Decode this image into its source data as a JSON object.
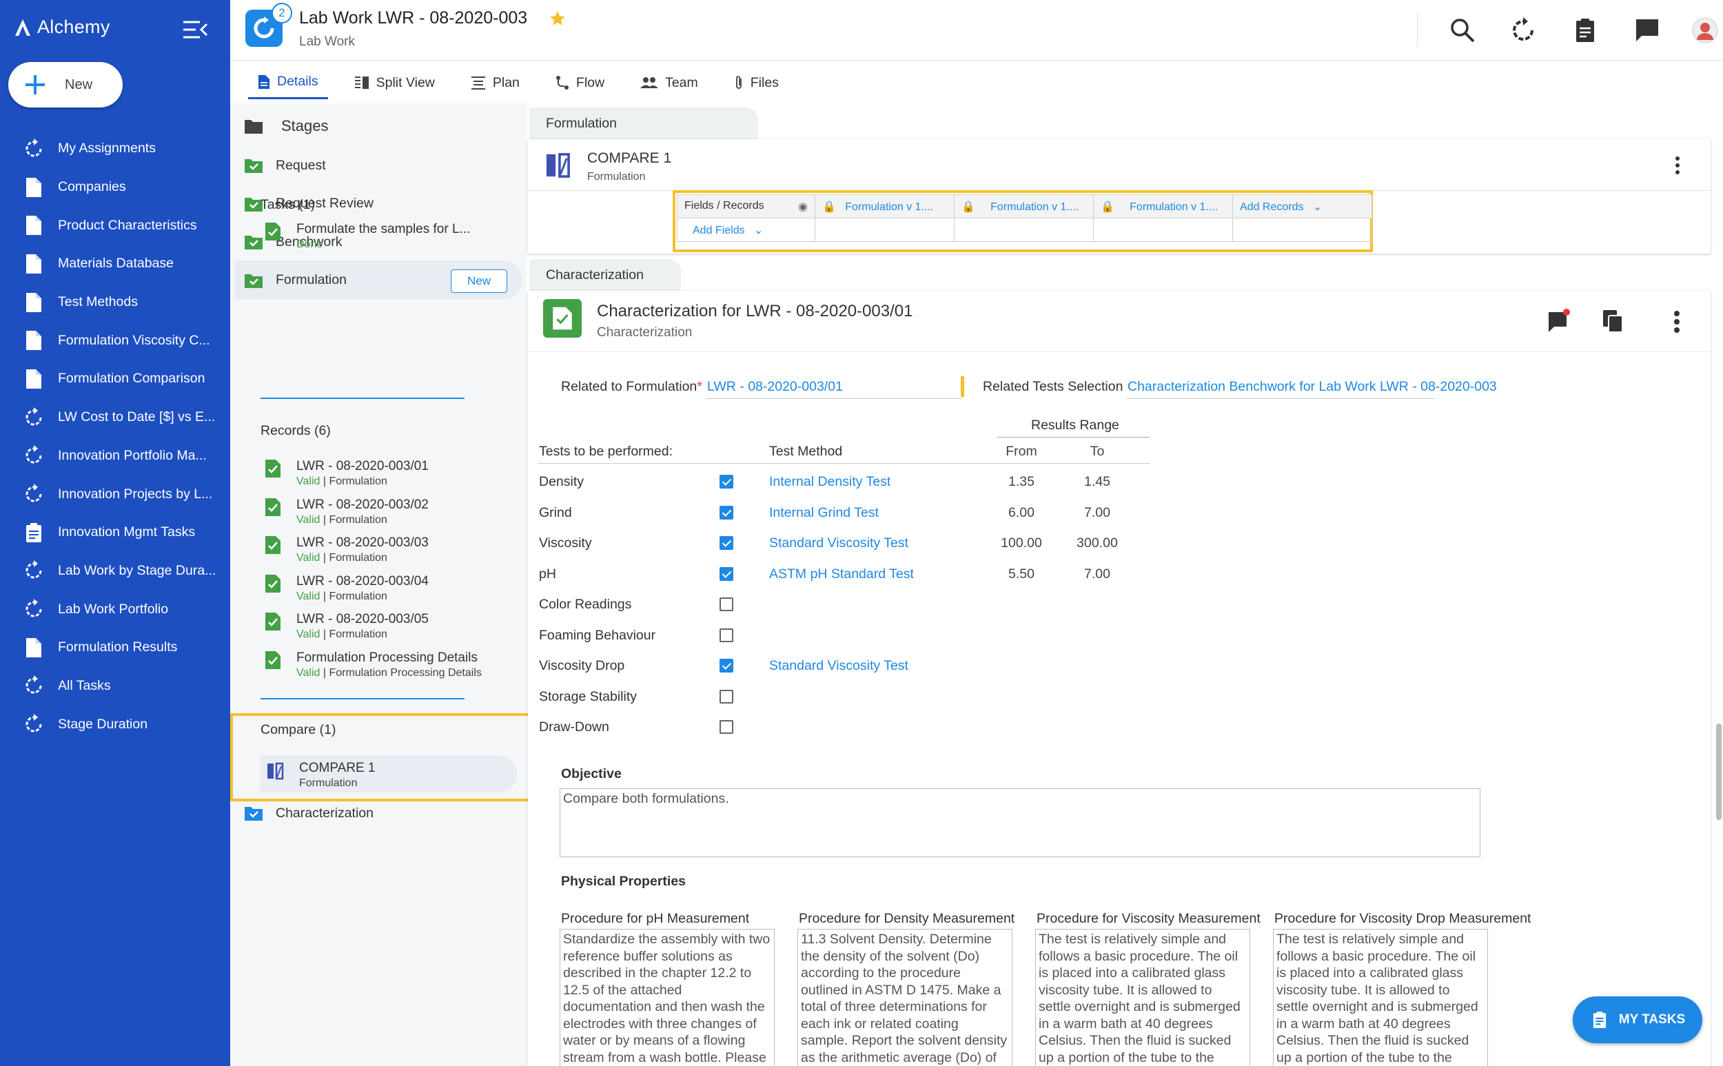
{
  "brand": {
    "name": "Alchemy"
  },
  "new_button": {
    "label": "New"
  },
  "nav": {
    "items": [
      {
        "label": "My Assignments",
        "icon": "cycle-icon"
      },
      {
        "label": "Companies",
        "icon": "document-icon"
      },
      {
        "label": "Product Characteristics",
        "icon": "document-icon"
      },
      {
        "label": "Materials Database",
        "icon": "document-icon"
      },
      {
        "label": "Test Methods",
        "icon": "document-icon"
      },
      {
        "label": "Formulation Viscosity C...",
        "icon": "document-icon"
      },
      {
        "label": "Formulation Comparison",
        "icon": "document-icon"
      },
      {
        "label": "LW Cost to Date [$] vs E...",
        "icon": "cycle-icon"
      },
      {
        "label": "Innovation Portfolio Ma...",
        "icon": "cycle-icon"
      },
      {
        "label": "Innovation Projects by L...",
        "icon": "cycle-icon"
      },
      {
        "label": "Innovation Mgmt Tasks",
        "icon": "clipboard-icon"
      },
      {
        "label": "Lab Work by Stage Dura...",
        "icon": "cycle-icon"
      },
      {
        "label": "Lab Work Portfolio",
        "icon": "cycle-icon"
      },
      {
        "label": "Formulation Results",
        "icon": "document-icon"
      },
      {
        "label": "All Tasks",
        "icon": "cycle-icon"
      },
      {
        "label": "Stage Duration",
        "icon": "cycle-icon"
      }
    ]
  },
  "header": {
    "title": "Lab Work LWR - 08-2020-003",
    "subtitle": "Lab Work",
    "badge": "2"
  },
  "tabs": [
    {
      "label": "Details"
    },
    {
      "label": "Split View"
    },
    {
      "label": "Plan"
    },
    {
      "label": "Flow"
    },
    {
      "label": "Team"
    },
    {
      "label": "Files"
    }
  ],
  "stages_panel": {
    "title": "Stages",
    "stages": [
      "Request",
      "Request Review",
      "Benchwork",
      "Formulation"
    ],
    "formulation_chip": "New",
    "tasks_title": "Tasks (1)",
    "task": {
      "name": "Formulate the samples for L...",
      "status": "Done"
    },
    "records_title": "Records (6)",
    "records": [
      {
        "name": "LWR - 08-2020-003/01",
        "status": "Valid",
        "type": "| Formulation"
      },
      {
        "name": "LWR - 08-2020-003/02",
        "status": "Valid",
        "type": "| Formulation"
      },
      {
        "name": "LWR - 08-2020-003/03",
        "status": "Valid",
        "type": "| Formulation"
      },
      {
        "name": "LWR - 08-2020-003/04",
        "status": "Valid",
        "type": "| Formulation"
      },
      {
        "name": "LWR - 08-2020-003/05",
        "status": "Valid",
        "type": "| Formulation"
      },
      {
        "name": "Formulation Processing Details",
        "status": "Valid",
        "type": "| Formulation Processing Details"
      }
    ],
    "compare_title": "Compare (1)",
    "compare_item": {
      "name": "COMPARE 1",
      "type": "Formulation"
    },
    "characterization": "Characterization"
  },
  "formulation_section": {
    "tab_label": "Formulation",
    "card_title": "COMPARE 1",
    "card_subtitle": "Formulation",
    "table": {
      "fields_records": "Fields / Records",
      "columns": [
        "Formulation v 1....",
        "Formulation v 1....",
        "Formulation v 1...."
      ],
      "add_records": "Add Records",
      "add_fields": "Add Fields"
    }
  },
  "characterization_section": {
    "tab_label": "Characterization",
    "title": "Characterization for LWR - 08-2020-003/01",
    "subtitle": "Characterization",
    "related_formulation_label": "Related to Formulation",
    "required_mark": "*",
    "related_formulation_value": "LWR - 08-2020-003/01",
    "related_tests_label": "Related Tests Selection",
    "related_tests_value": "Characterization Benchwork for Lab Work LWR - 08-2020-003",
    "results_range": "Results Range",
    "col_tests": "Tests to be performed:",
    "col_method": "Test Method",
    "col_from": "From",
    "col_to": "To",
    "tests": [
      {
        "name": "Density",
        "checked": true,
        "method": "Internal Density Test",
        "from": "1.35",
        "to": "1.45"
      },
      {
        "name": "Grind",
        "checked": true,
        "method": "Internal Grind Test",
        "from": "6.00",
        "to": "7.00"
      },
      {
        "name": "Viscosity",
        "checked": true,
        "method": "Standard Viscosity Test",
        "from": "100.00",
        "to": "300.00"
      },
      {
        "name": "pH",
        "checked": true,
        "method": "ASTM pH Standard Test",
        "from": "5.50",
        "to": "7.00"
      },
      {
        "name": "Color Readings",
        "checked": false,
        "method": "",
        "from": "",
        "to": ""
      },
      {
        "name": "Foaming Behaviour",
        "checked": false,
        "method": "",
        "from": "",
        "to": ""
      },
      {
        "name": "Viscosity Drop",
        "checked": true,
        "method": "Standard Viscosity Test",
        "from": "",
        "to": ""
      },
      {
        "name": "Storage Stability",
        "checked": false,
        "method": "",
        "from": "",
        "to": ""
      },
      {
        "name": "Draw-Down",
        "checked": false,
        "method": "",
        "from": "",
        "to": ""
      }
    ],
    "objective_label": "Objective",
    "objective_value": "Compare both formulations.",
    "physical_properties_label": "Physical Properties",
    "procedures": [
      {
        "label": "Procedure for pH Measurement",
        "text": "Standardize the assembly with two reference buffer solutions as described in the chapter 12.2 to 12.5 of the attached documentation and then wash the electrodes with three changes of water or by means of a flowing stream from a wash bottle. Please"
      },
      {
        "label": "Procedure for Density Measurement",
        "text": "11.3 Solvent Density. Determine the density of the solvent (Do) according to the procedure outlined in ASTM D 1475. Make a total of three determinations for each ink or related coating sample. Report the solvent density as the arithmetic average (Do) of the"
      },
      {
        "label": "Procedure for Viscosity Measurement",
        "text": "The test is relatively simple and follows a basic procedure. The oil is placed into a calibrated glass viscosity tube. It is allowed to settle overnight and is submerged in a warm bath at 40 degrees Celsius. Then the fluid is sucked up a portion of the tube to the"
      },
      {
        "label": "Procedure for Viscosity Drop Measurement",
        "text": "The test is relatively simple and follows a basic procedure. The oil is placed into a calibrated glass viscosity tube. It is allowed to settle overnight and is submerged in a warm bath at 40 degrees Celsius. Then the fluid is sucked up a portion of the tube to the"
      }
    ]
  },
  "my_tasks": {
    "label": "MY TASKS"
  },
  "colors": {
    "nav_bg": "#1d4fc1",
    "accent": "#1e88e5",
    "highlight": "#f5c02e",
    "valid": "#43a047"
  }
}
